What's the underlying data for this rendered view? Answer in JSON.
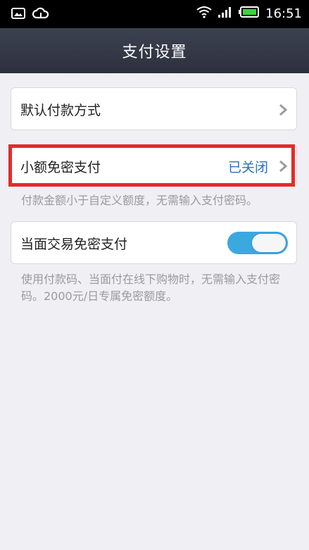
{
  "status_bar": {
    "time": "16:51",
    "icons": [
      "image-icon",
      "cloud-icon",
      "wifi-icon",
      "signal-icon",
      "battery-icon"
    ],
    "color": "#000000"
  },
  "nav": {
    "title": "支付设置",
    "color": "#2d313e"
  },
  "settings": {
    "default_payment": {
      "label": "默认付款方式"
    },
    "small_amount": {
      "label": "小额免密支付",
      "value": "已关闭"
    },
    "small_amount_note": "付款金额小于自定义额度，无需输入支付密码。",
    "face_to_face": {
      "label": "当面交易免密支付",
      "toggle_on": true
    },
    "face_to_face_note": "使用付款码、当面付在线下购物时，无需输入支付密码。2000元/日专属免密额度。"
  },
  "colors": {
    "accent": "#2a6fc6",
    "toggle_on": "#3aa9e0",
    "highlight": "#e52a2a",
    "background": "#efeff4"
  }
}
